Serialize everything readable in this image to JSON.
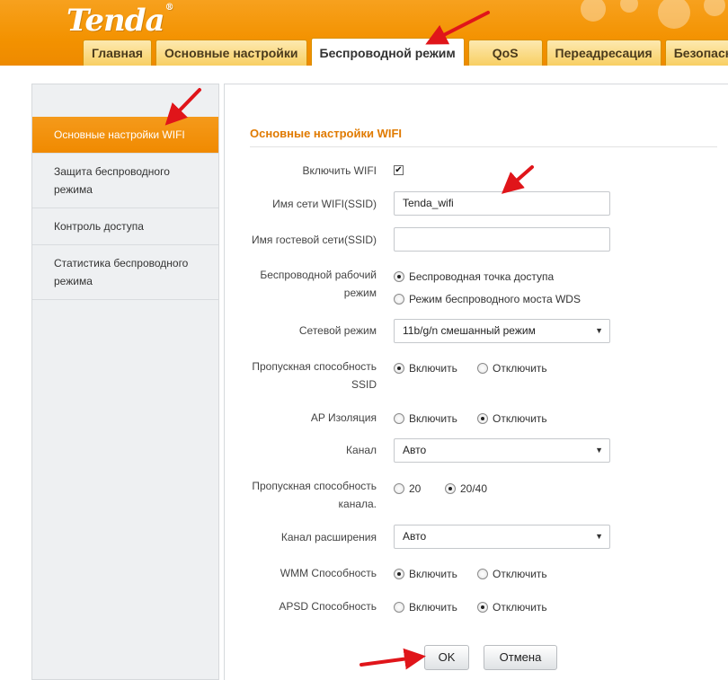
{
  "brand": {
    "logo": "Tenda",
    "reg_mark": "®"
  },
  "tabs": [
    {
      "label": "Главная"
    },
    {
      "label": "Основные настройки"
    },
    {
      "label": "Беспроводной режим",
      "active": true
    },
    {
      "label": "QoS"
    },
    {
      "label": "Переадресация"
    },
    {
      "label": "Безопасно"
    }
  ],
  "sidebar": {
    "items": [
      {
        "label": "Основные настройки WIFI",
        "active": true
      },
      {
        "label": "Защита беспроводного режима"
      },
      {
        "label": "Контроль доступа"
      },
      {
        "label": "Статистика беспроводного режима"
      }
    ]
  },
  "form": {
    "title": "Основные настройки WIFI",
    "enable_wifi": {
      "label": "Включить WIFI",
      "checked": true,
      "check_glyph": "✔"
    },
    "ssid": {
      "label": "Имя сети WIFI(SSID)",
      "value": "Tenda_wifi"
    },
    "guest_ssid": {
      "label": "Имя гостевой сети(SSID)",
      "value": ""
    },
    "mode": {
      "label_line1": "Беспроводной рабочий",
      "label_line2": "режим",
      "options": [
        "Беспроводная точка доступа",
        "Режим беспроводного моста WDS"
      ],
      "selected": 0
    },
    "net_mode": {
      "label": "Сетевой режим",
      "value": "11b/g/n смешанный режим"
    },
    "ssid_broadcast": {
      "label_line1": "Пропускная способность",
      "label_line2": "SSID",
      "on": "Включить",
      "off": "Отключить",
      "selected": "on"
    },
    "ap_isolation": {
      "label": "AP Изоляция",
      "on": "Включить",
      "off": "Отключить",
      "selected": "off"
    },
    "channel": {
      "label": "Канал",
      "value": "Авто"
    },
    "bandwidth": {
      "label_line1": "Пропускная способность",
      "label_line2": "канала.",
      "opt1": "20",
      "opt2": "20/40",
      "selected": "20/40"
    },
    "ext_channel": {
      "label": "Канал расширения",
      "value": "Авто"
    },
    "wmm": {
      "label": "WMM Способность",
      "on": "Включить",
      "off": "Отключить",
      "selected": "on"
    },
    "apsd": {
      "label": "APSD Способность",
      "on": "Включить",
      "off": "Отключить",
      "selected": "off"
    },
    "ok_button": "OK",
    "cancel_button": "Отмена"
  },
  "colors": {
    "header_orange": "#f39200",
    "active_tab_text": "#333333",
    "title_orange": "#e07a00",
    "arrow_red": "#e0151a"
  }
}
